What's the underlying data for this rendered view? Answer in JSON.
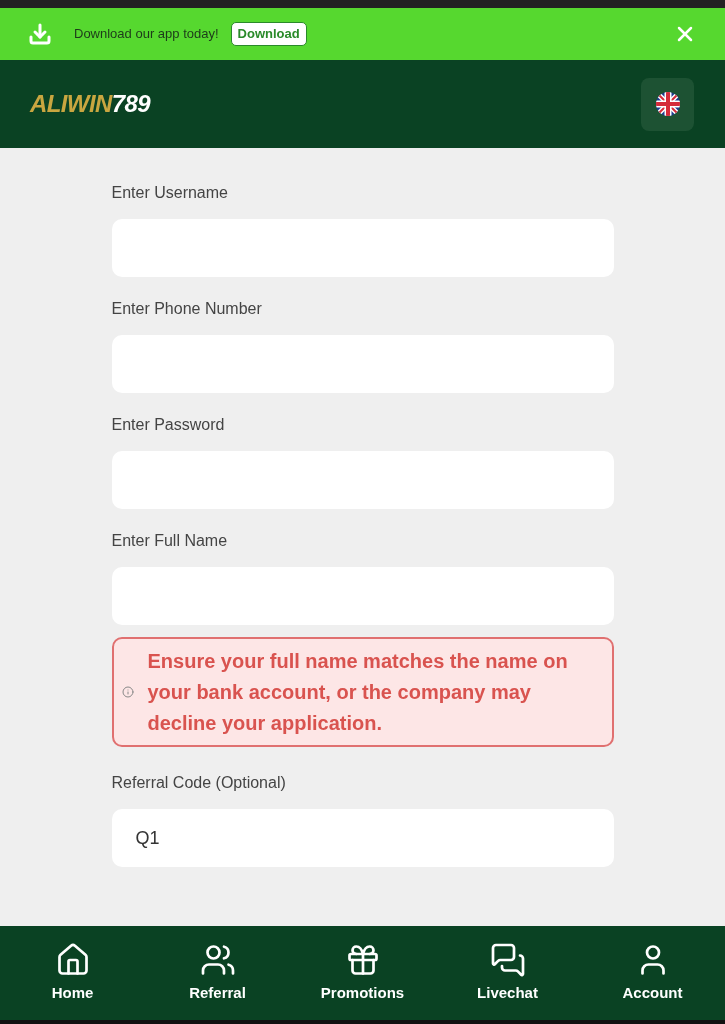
{
  "banner": {
    "message": "Download our app today!",
    "button": "Download"
  },
  "header": {
    "logo": {
      "gold": "ALIWIN",
      "white": "789"
    }
  },
  "fields": [
    {
      "label": "Enter Username"
    },
    {
      "label": "Enter Phone Number"
    },
    {
      "label": "Enter Password"
    },
    {
      "label": "Enter Full Name"
    },
    {
      "kind": "warning",
      "text": "Ensure your full name matches the name on your bank account, or the company may decline your application."
    },
    {
      "label": "Referral Code (Optional)",
      "value": "Q1"
    }
  ],
  "nav": [
    {
      "label": "Home",
      "kind": "home"
    },
    {
      "label": "Referral",
      "kind": "users"
    },
    {
      "label": "Promotions",
      "kind": "gift"
    },
    {
      "label": "Livechat",
      "kind": "chat"
    },
    {
      "label": "Account",
      "kind": "user"
    }
  ]
}
